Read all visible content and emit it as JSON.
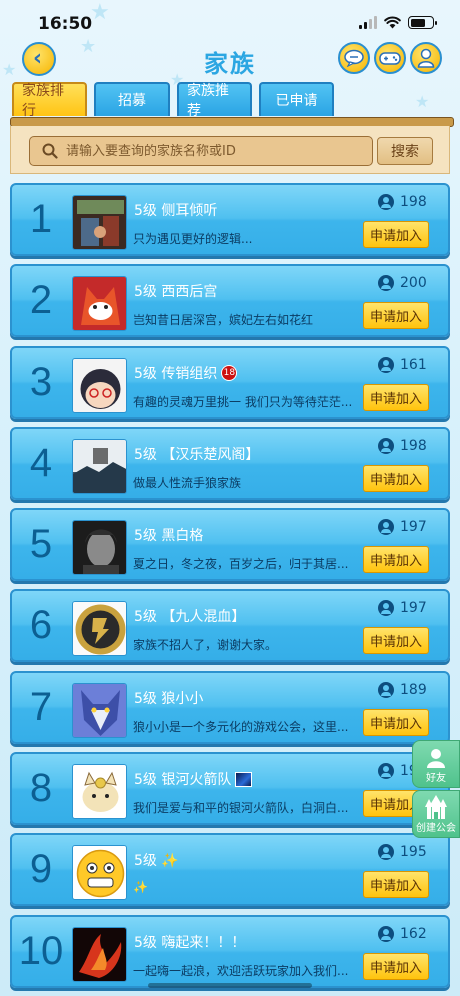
{
  "status_bar": {
    "time": "16:50"
  },
  "header": {
    "title": "家族"
  },
  "tabs": [
    {
      "label": "家族排行",
      "active": true
    },
    {
      "label": "招募",
      "active": false
    },
    {
      "label": "家族推荐",
      "active": false
    },
    {
      "label": "已申请",
      "active": false
    }
  ],
  "search": {
    "placeholder": "请输入要查询的家族名称或ID",
    "button_label": "搜索"
  },
  "rows": [
    {
      "rank": "1",
      "name": "5级  侧耳倾听",
      "badge": "",
      "desc": "只为遇见更好的逻辑...",
      "members": "198",
      "join_label": "申请加入"
    },
    {
      "rank": "2",
      "name": "5级  西西后宫",
      "badge": "",
      "desc": "岂知昔日居深宫，嫔妃左右如花红",
      "members": "200",
      "join_label": "申请加入"
    },
    {
      "rank": "3",
      "name": "5级  传销组织",
      "badge": "18",
      "desc": "有趣的灵魂万里挑一  我们只为等待茫茫...",
      "members": "161",
      "join_label": "申请加入"
    },
    {
      "rank": "4",
      "name": "5级  【汉乐楚风阁】",
      "badge": "",
      "desc": "做最人性流手狼家族",
      "members": "198",
      "join_label": "申请加入"
    },
    {
      "rank": "5",
      "name": "5级  黑白格",
      "badge": "",
      "desc": "夏之日，冬之夜，百岁之后，归于其居...",
      "members": "197",
      "join_label": "申请加入"
    },
    {
      "rank": "6",
      "name": "5级  【九人混血】",
      "badge": "",
      "desc": "家族不招人了，谢谢大家。",
      "members": "197",
      "join_label": "申请加入"
    },
    {
      "rank": "7",
      "name": "5级  狼小小",
      "badge": "",
      "desc": "狼小小是一个多元化的游戏公会，这里...",
      "members": "189",
      "join_label": "申请加入"
    },
    {
      "rank": "8",
      "name": "5级  银河火箭队",
      "badge": "img",
      "desc": "我们是爱与和平的银河火箭队，白洞白...",
      "members": "19",
      "join_label": "申请加入"
    },
    {
      "rank": "9",
      "name": "5级  ✨",
      "badge": "",
      "desc": "✨",
      "members": "195",
      "join_label": "申请加入"
    },
    {
      "rank": "10",
      "name": "5级  嗨起来！！！",
      "badge": "",
      "desc": "一起嗨一起浪，欢迎活跃玩家加入我们...",
      "members": "162",
      "join_label": "申请加入"
    }
  ],
  "floating": {
    "friends_label": "好友",
    "create_label": "创建公会"
  },
  "colors": {
    "accent_blue": "#2ba6e2",
    "active_tab": "#ffc414",
    "join_button": "#ffc30d"
  }
}
